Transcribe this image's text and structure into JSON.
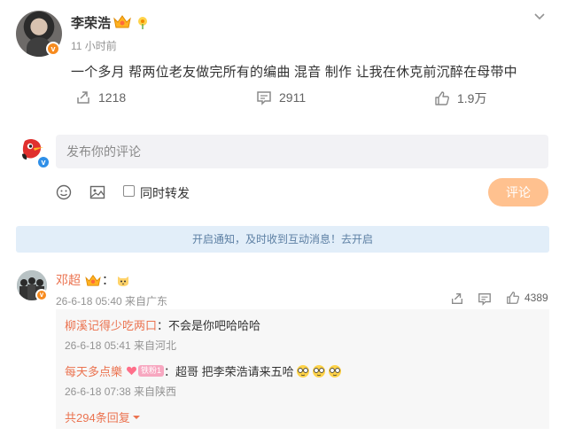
{
  "post": {
    "author": "李荣浩",
    "time": "11 小时前",
    "text": "一个多月 帮两位老友做完所有的编曲 混音 制作 让我在休克前沉醉在母带中",
    "repost_count": "1218",
    "comment_count": "2911",
    "like_count": "1.9万"
  },
  "composer": {
    "placeholder": "发布你的评论",
    "repost_option": "同时转发",
    "submit_label": "评论"
  },
  "notice": {
    "text": "开启通知，及时收到互动消息！去开启"
  },
  "comment": {
    "author": "邓超",
    "text": "：",
    "meta": "26-6-18 05:40 来自广东",
    "like_count": "4389",
    "replies": [
      {
        "author": "柳溪记得少吃两口",
        "text": "：不会是你吧哈哈哈",
        "meta": "26-6-18 05:41 来自河北"
      },
      {
        "author": "每天多点樂",
        "badge": "铁粉1",
        "text": "：超哥 把李荣浩请来五哈",
        "meta": "26-6-18 07:38 来自陕西"
      }
    ],
    "more_replies": "共294条回复"
  },
  "colors": {
    "accent_orange": "#eb7350",
    "notice_bg": "#e2eef9",
    "notice_text": "#5c7fa3",
    "submit_disabled": "#ffc18f"
  }
}
